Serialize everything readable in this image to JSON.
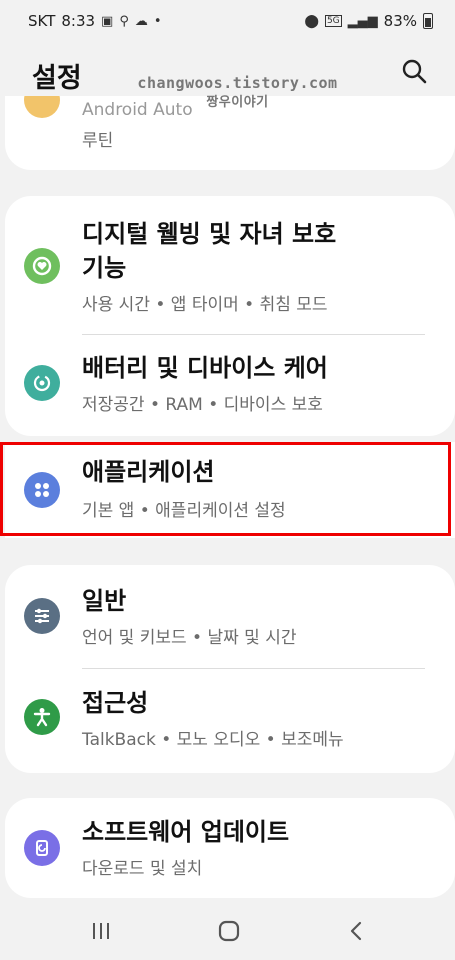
{
  "status": {
    "carrier": "SKT",
    "time": "8:33",
    "battery": "83%",
    "network_badge": "5G"
  },
  "appbar": {
    "title": "설정"
  },
  "watermark": {
    "line1": "changwoos.tistory.com",
    "line2": "짱우이야기"
  },
  "partial_item": {
    "title_cut": "Android Auto",
    "sub": "루틴"
  },
  "items": [
    {
      "title1": "디지털 웰빙 및 자녀 보호",
      "title2": "기능",
      "sub": "사용 시간 • 앱 타이머 • 취침 모드",
      "icon": "digital-wellbeing-icon",
      "color": "#6fbf5e"
    },
    {
      "title1": "배터리 및 디바이스 케어",
      "sub": "저장공간 • RAM • 디바이스 보호",
      "icon": "device-care-icon",
      "color": "#3fae9d"
    },
    {
      "title1": "애플리케이션",
      "sub": "기본 앱 • 애플리케이션 설정",
      "icon": "apps-icon",
      "color": "#5b7fdd"
    },
    {
      "title1": "일반",
      "sub": "언어 및 키보드 • 날짜 및 시간",
      "icon": "general-icon",
      "color": "#5a6f84"
    },
    {
      "title1": "접근성",
      "sub": "TalkBack • 모노 오디오 • 보조메뉴",
      "icon": "accessibility-icon",
      "color": "#2f9b48"
    },
    {
      "title1": "소프트웨어 업데이트",
      "sub": "다운로드 및 설치",
      "icon": "software-update-icon",
      "color": "#7a6fe6"
    }
  ],
  "accent": {
    "highlight_border": "#ee0000"
  }
}
